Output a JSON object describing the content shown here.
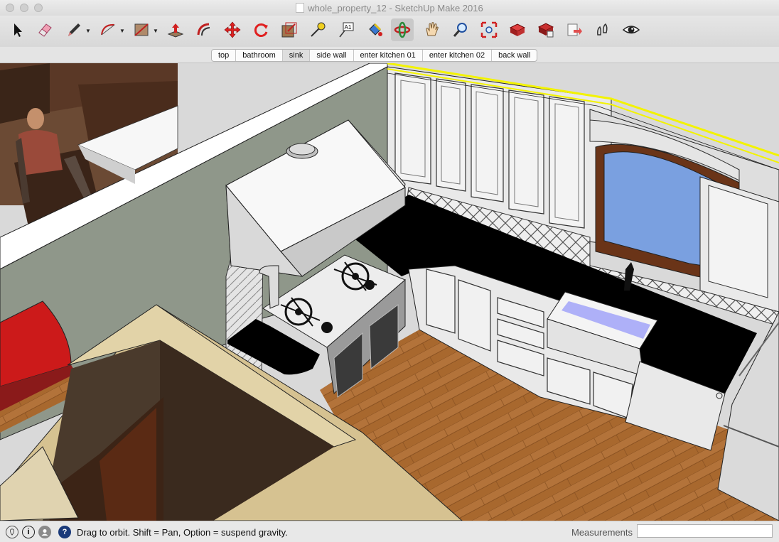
{
  "window": {
    "title": "whole_property_12 - SketchUp Make 2016"
  },
  "toolbar": {
    "tools": [
      {
        "name": "select-tool",
        "icon": "arrow-cursor-icon"
      },
      {
        "name": "eraser-tool",
        "icon": "eraser-icon"
      },
      {
        "name": "line-tool",
        "icon": "pencil-icon"
      },
      {
        "name": "arc-tool",
        "icon": "arc-icon"
      },
      {
        "name": "shapes-tool",
        "icon": "rectangle-icon"
      },
      {
        "name": "push-pull-tool",
        "icon": "push-pull-icon"
      },
      {
        "name": "offset-tool",
        "icon": "offset-icon"
      },
      {
        "name": "move-tool",
        "icon": "move-arrows-icon"
      },
      {
        "name": "rotate-tool",
        "icon": "rotate-icon"
      },
      {
        "name": "scale-tool",
        "icon": "scale-icon"
      },
      {
        "name": "tape-measure-tool",
        "icon": "tape-measure-icon"
      },
      {
        "name": "text-tool",
        "icon": "text-label-icon"
      },
      {
        "name": "paint-bucket-tool",
        "icon": "paint-bucket-icon"
      },
      {
        "name": "orbit-tool",
        "icon": "orbit-icon"
      },
      {
        "name": "pan-tool",
        "icon": "hand-icon"
      },
      {
        "name": "zoom-tool",
        "icon": "magnifier-icon"
      },
      {
        "name": "zoom-extents-tool",
        "icon": "zoom-extents-icon"
      },
      {
        "name": "warehouse-tool",
        "icon": "3d-warehouse-icon"
      },
      {
        "name": "extension-warehouse-tool",
        "icon": "extension-warehouse-icon"
      },
      {
        "name": "share-model-tool",
        "icon": "share-model-icon"
      },
      {
        "name": "walk-tool",
        "icon": "walk-feet-icon"
      },
      {
        "name": "look-around-tool",
        "icon": "eye-icon"
      }
    ],
    "text_tool_glyph": "A1",
    "active_tool": "orbit-tool"
  },
  "scenes": {
    "tabs": [
      "top",
      "bathroom",
      "sink",
      "side wall",
      "enter kitchen 01",
      "enter kitchen 02",
      "back wall"
    ],
    "active": "sink"
  },
  "statusbar": {
    "hint": "Drag to orbit. Shift = Pan, Option = suspend gravity.",
    "measurements_label": "Measurements",
    "measurements_value": "",
    "help_glyph": "?",
    "info_glyph": "i"
  },
  "colors": {
    "accent_selection": "#f3f300",
    "countertop": "#000000",
    "cabinet": "#e9e9e9",
    "floor": "#a8682e",
    "wall": "#8f978a"
  }
}
